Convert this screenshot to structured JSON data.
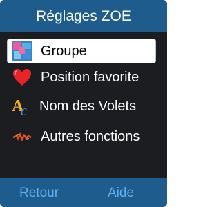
{
  "header": {
    "title": "Réglages ZOE"
  },
  "menu": {
    "items": [
      {
        "label": "Groupe",
        "icon": "group-icon",
        "selected": true
      },
      {
        "label": "Position favorite",
        "icon": "heart-icon",
        "selected": false
      },
      {
        "label": "Nom des Volets",
        "icon": "text-icon",
        "selected": false
      },
      {
        "label": "Autres fonctions",
        "icon": "functions-icon",
        "selected": false
      }
    ]
  },
  "softkeys": {
    "left": "Retour",
    "right": "Aide"
  },
  "colors": {
    "title_bar": "#1e5c8e",
    "background": "#1b1d20",
    "softkey_text": "#5fb0ef",
    "selected_bg": "#ffffff"
  }
}
